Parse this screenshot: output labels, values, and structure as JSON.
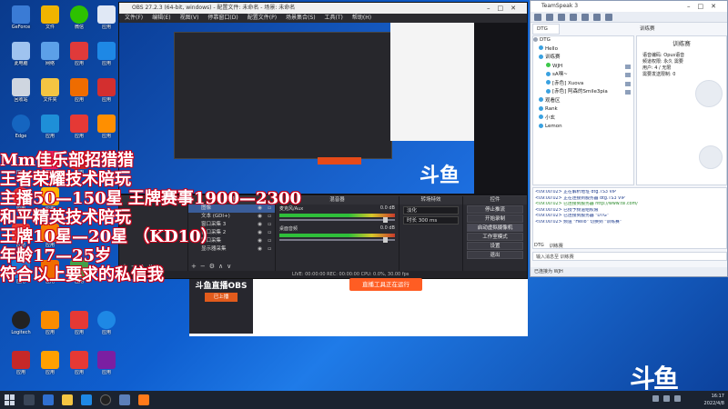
{
  "overlay_text": [
    "Mm佳乐部招猎猎",
    "王者荣耀技术陪玩",
    "主播50—150星 王牌赛事1900—2300",
    "和平精英技术陪玩",
    "王牌10星—20星 （KD10）",
    "年龄17—25岁",
    "符合以上要求的私信我"
  ],
  "obs": {
    "title": "OBS 27.2.3 (64-bit, windows) - 配置文件: 未命名 - 场景: 未命名",
    "menu": [
      "文件(F)",
      "编辑(E)",
      "视图(V)",
      "停靠窗口(D)",
      "配置文件(P)",
      "场景集合(S)",
      "工具(T)",
      "帮助(H)"
    ],
    "preview_logo": "斗鱼",
    "docks": {
      "scenes": "来源",
      "sources_title": "来源",
      "mixer_title": "混音器",
      "transitions_title": "转场特效",
      "controls_title": "控件"
    },
    "scene_label": "未设置",
    "sources": [
      {
        "name": "图像"
      },
      {
        "name": "文本 (GDI+)"
      },
      {
        "name": "窗口采集 3"
      },
      {
        "name": "窗口采集 2"
      },
      {
        "name": "窗口采集"
      },
      {
        "name": "显示器采集"
      }
    ],
    "mixer": [
      {
        "name": "麦克风/Aux",
        "db": "0.0 dB"
      },
      {
        "name": "桌面音频",
        "db": "0.0 dB"
      }
    ],
    "transition": {
      "type": "淡化",
      "duration_label": "时长",
      "duration": "300 ms"
    },
    "controls": [
      "停止推流",
      "开始录制",
      "启动虚拟摄像机",
      "工作室模式",
      "设置",
      "退出"
    ],
    "status": "LIVE: 00:00:00   REC: 00:00:00   CPU: 0.0%, 30.00 fps"
  },
  "stream": {
    "promo": "斗鱼直播OBS",
    "promo_btn": "已上播",
    "live_btn": "直播工具正在运行"
  },
  "teamspeak": {
    "title": "TeamSpeak 3",
    "tab": "DTG",
    "tab2": "训练赛",
    "tree": [
      {
        "label": "DTG",
        "type": "server"
      },
      {
        "label": "Hello",
        "type": "channel"
      },
      {
        "label": "训练赛",
        "type": "channel"
      },
      {
        "label": "WJH",
        "type": "user"
      },
      {
        "label": "sA嘿~",
        "type": "user"
      },
      {
        "label": "[赤色] Xuova",
        "type": "user"
      },
      {
        "label": "[赤色] 阿森的Smile3pia",
        "type": "user"
      },
      {
        "label": "观看区",
        "type": "channel"
      },
      {
        "label": "Rank",
        "type": "channel"
      },
      {
        "label": "小玄",
        "type": "channel"
      },
      {
        "label": "Lemon",
        "type": "channel"
      }
    ],
    "info": {
      "name": "训练赛",
      "rows": [
        "语音编码: Opus语音",
        "频道权限: 永久 需要",
        "用户: 4 / 无限",
        "需要发送限制: 0"
      ]
    },
    "chat": [
      "<09:00:02> 正在解析地址 dtg.TS3 VIP",
      "<09:00:02> 正在连接到服务器 dtg.TS3 VIP",
      "<09:00:02> 已连接到服务器 http://www.tsl.com/",
      "<09:00:02> 已授予频道组权限",
      "<09:00:02> 已连接到服务器 \"DTG\"",
      "<09:00:02> 频道 \"Hello\" 切换到 \"训练赛\""
    ],
    "chat_tabs": [
      "DTG",
      "训练赛"
    ],
    "input_placeholder": "输入消息至 训练赛",
    "status": "已连接为 WJH"
  },
  "watermark": "斗鱼",
  "taskbar": {
    "time": "16:17",
    "date": "2022/4/8"
  }
}
